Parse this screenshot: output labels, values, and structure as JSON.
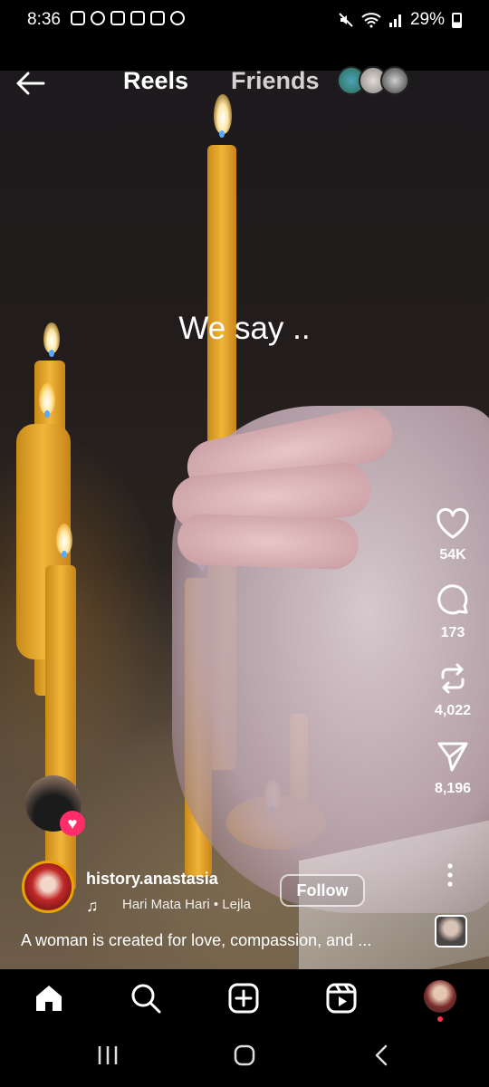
{
  "status_bar": {
    "time": "8:36",
    "battery": "29%"
  },
  "top_nav": {
    "tabs": [
      {
        "label": "Reels"
      },
      {
        "label": "Friends"
      }
    ]
  },
  "video": {
    "overlay_text": "We say .."
  },
  "actions": {
    "likes": "54K",
    "comments": "173",
    "reposts": "4,022",
    "shares": "8,196"
  },
  "post": {
    "author": "history.anastasia",
    "music": "Hari Mata Hari • Lejla",
    "follow_label": "Follow",
    "caption": "A woman is created for love, compassion, and ..."
  },
  "icons": {
    "back": "arrow-left-icon",
    "like": "heart-icon",
    "comment": "comment-bubble-icon",
    "repost": "repost-icon",
    "share": "paper-plane-icon",
    "more": "more-vertical-icon",
    "music": "music-note-icon",
    "home": "home-icon",
    "search": "search-icon",
    "create": "add-square-icon",
    "reels": "reels-icon"
  },
  "colors": {
    "like_badge": "#ff2d6a",
    "notification_dot": "#ff3040",
    "story_ring": "#e9a400"
  }
}
